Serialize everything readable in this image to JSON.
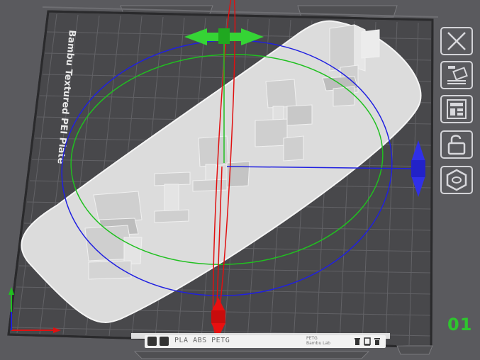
{
  "plate": {
    "name": "Bambu Textured PEI Plate",
    "number": "01"
  },
  "filament": {
    "label": "PLA ABS PETG",
    "info_line1": "PETG",
    "info_line2": "Bambu Lab"
  },
  "gizmo": {
    "x_axis_color": "#e01010",
    "y_axis_color": "#20c020",
    "z_axis_color": "#2020e0"
  },
  "sidebar": {
    "buttons": [
      {
        "name": "close-icon"
      },
      {
        "name": "auto-orient-icon"
      },
      {
        "name": "arrange-icon"
      },
      {
        "name": "lock-icon"
      },
      {
        "name": "plate-settings-icon"
      }
    ]
  },
  "colors": {
    "plate": "#4a4a4d",
    "grid": "#6a6a6e",
    "part": "#d9d9d9",
    "accent_green": "#2ec52e"
  }
}
